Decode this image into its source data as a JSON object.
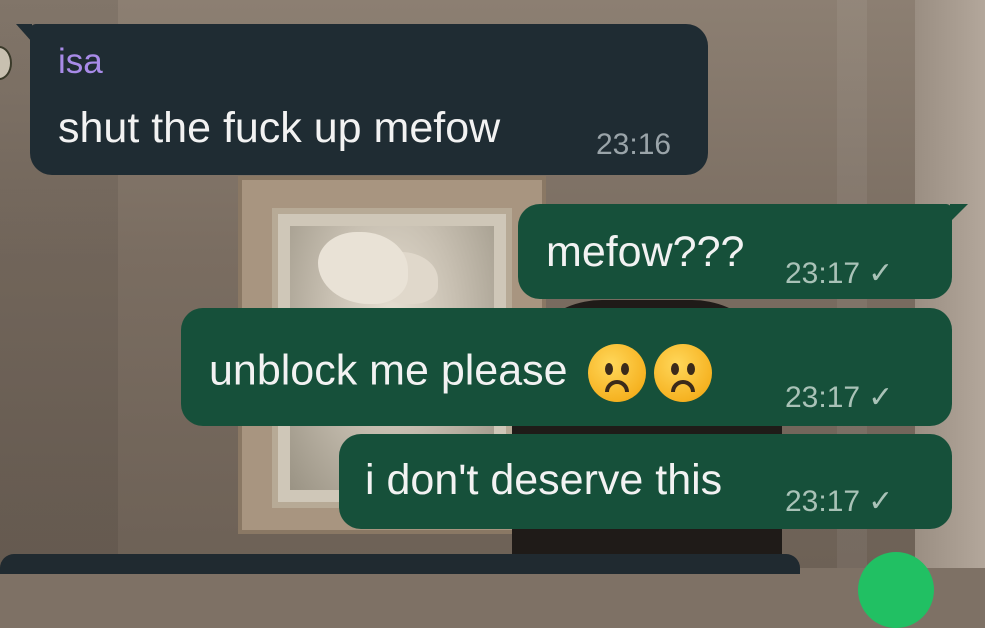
{
  "messages": [
    {
      "sender": "isa",
      "text": "shut the fuck up mefow",
      "time": "23:16",
      "direction": "incoming"
    },
    {
      "text": "mefow???",
      "time": "23:17",
      "direction": "outgoing",
      "status": "sent-check"
    },
    {
      "text": "unblock me please",
      "emojis": [
        "frowning-face",
        "frowning-face"
      ],
      "time": "23:17",
      "direction": "outgoing",
      "status": "sent-check"
    },
    {
      "text": "i don't deserve this",
      "time": "23:17",
      "direction": "outgoing",
      "status": "sent-check"
    }
  ],
  "icons": {
    "check": "✓"
  },
  "colors": {
    "incoming_bubble": "#1f2c33",
    "outgoing_bubble": "#16503a",
    "sender_name": "#a88be8",
    "fab": "#21c063"
  }
}
